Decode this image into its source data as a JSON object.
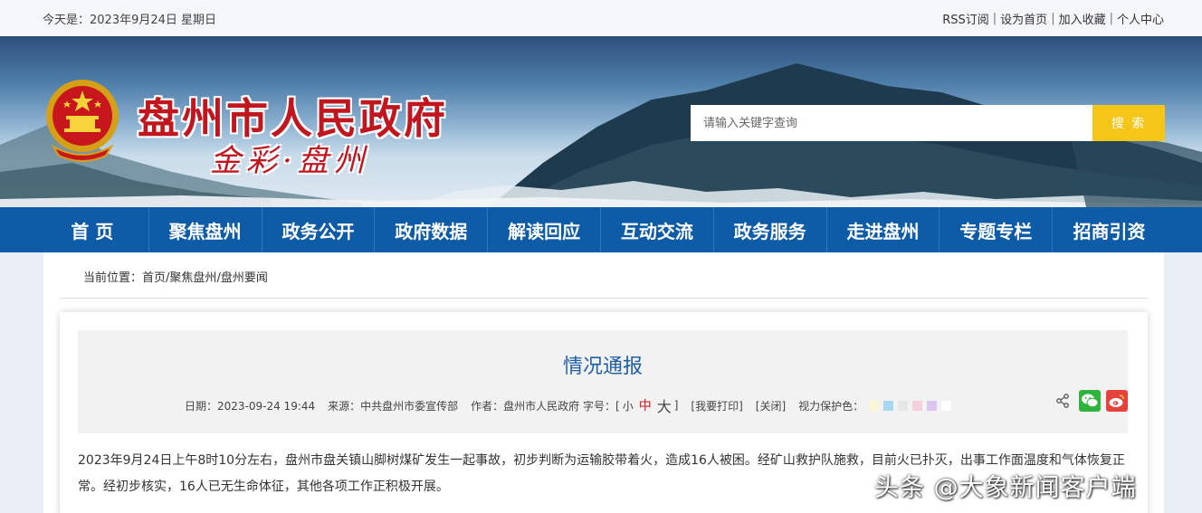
{
  "topbar": {
    "date": "今天是：2023年9月24日 星期日",
    "links": [
      "RSS订阅",
      "设为首页",
      "加入收藏",
      "个人中心"
    ]
  },
  "header": {
    "title": "盘州市人民政府",
    "slogan": "金彩·盘州",
    "emblem_icon": "national-emblem-icon",
    "search_placeholder": "请输入关键字查询",
    "search_button": "搜 索"
  },
  "nav": [
    "首 页",
    "聚焦盘州",
    "政务公开",
    "政府数据",
    "解读回应",
    "互动交流",
    "政务服务",
    "走进盘州",
    "专题专栏",
    "招商引资"
  ],
  "breadcrumb": {
    "label": "当前位置：",
    "items": [
      "首页",
      "聚焦盘州",
      "盘州要闻"
    ],
    "separator": "/"
  },
  "article": {
    "title": "情况通报",
    "date": "日期：2023-09-24 19:44",
    "source": "来源：中共盘州市委宣传部",
    "author": "作者：盘州市人民政府",
    "fontsize_label": "字号：[",
    "font_small": "小",
    "font_medium": "中",
    "font_large": "大",
    "fontsize_end": "]",
    "print": "[我要打印]",
    "close": "[关闭]",
    "eye_protect": "视力保护色：",
    "swatch_colors": [
      "#fbf6d6",
      "#a8d8ef",
      "#e6e6e6",
      "#f5d0dc",
      "#dcc6f0",
      "#ffffff"
    ],
    "share_icons": [
      "share-icon",
      "wechat-icon",
      "weibo-icon"
    ],
    "body": "2023年9月24日上午8时10分左右，盘州市盘关镇山脚树煤矿发生一起事故，初步判断为运输胶带着火，造成16人被困。经矿山救护队施救，目前火已扑灭，出事工作面温度和气体恢复正常。经初步核实，16人已无生命体征，其他各项工作正积极开展。"
  },
  "watermark": "头条 @大象新闻客户端",
  "colors": {
    "nav": "#0e5ba8",
    "title_red": "#c2161f",
    "search_button": "#f5c518",
    "article_title": "#1f5fa8"
  }
}
